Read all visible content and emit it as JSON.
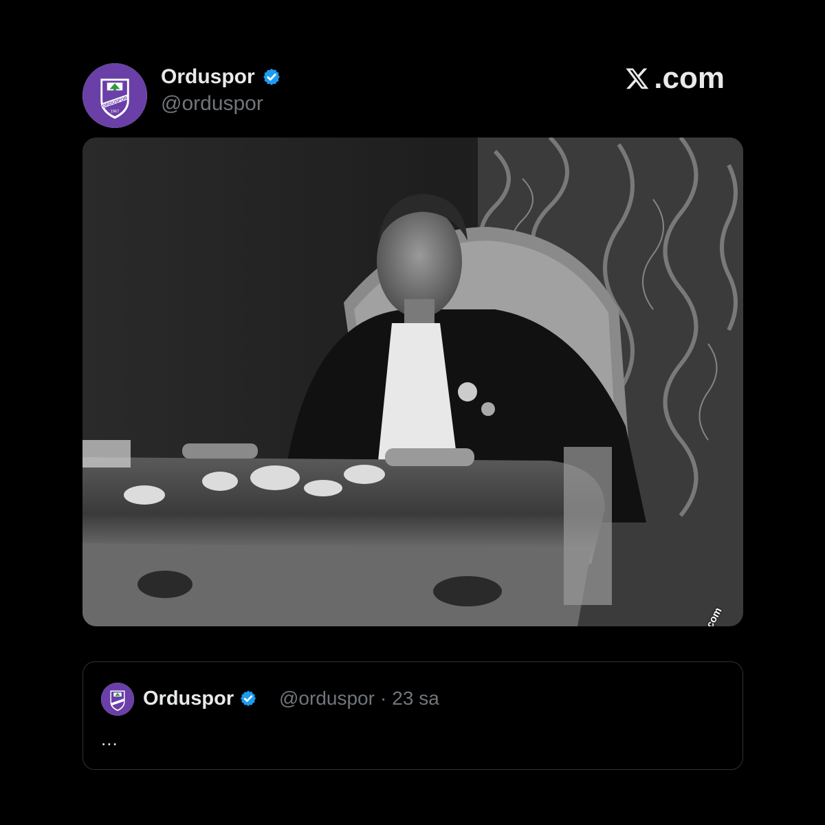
{
  "header": {
    "name": "Orduspor",
    "handle": "@orduspor",
    "verified_icon": "verified-badge-icon",
    "avatar_logo_text": "ORDUSPOR",
    "avatar_logo_year": "1967"
  },
  "brand": {
    "text": ".com",
    "icon": "x-logo-icon"
  },
  "photo": {
    "watermark": "www.isteataturk.com"
  },
  "quoted_post": {
    "name": "Orduspor",
    "handle": "@orduspor",
    "separator": "·",
    "time": "23 sa",
    "body": "..."
  },
  "colors": {
    "background": "#000000",
    "text_primary": "#e7e9ea",
    "text_secondary": "#71767b",
    "verified_blue": "#1d9bf0",
    "club_purple": "#6a3fa8",
    "border": "#2f3336"
  }
}
